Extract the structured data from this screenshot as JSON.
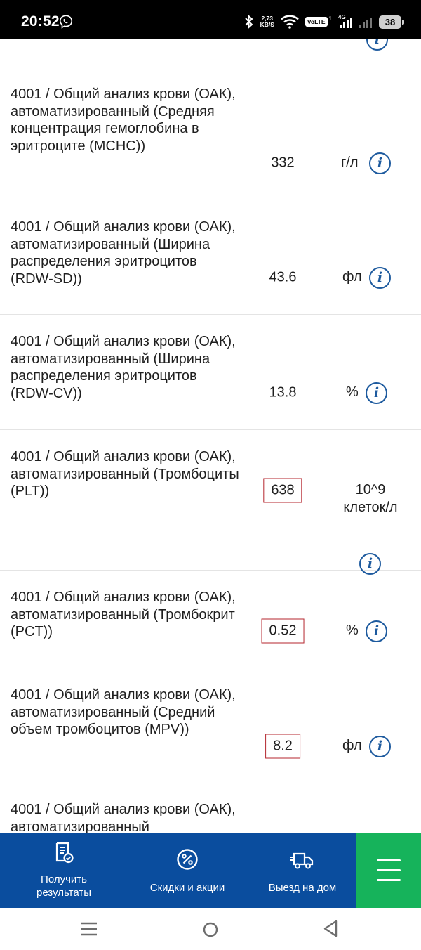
{
  "status_bar": {
    "time": "20:52",
    "speed_value": "2,73",
    "speed_unit": "KB/S",
    "volte": "VoLTE",
    "sim": "1",
    "network": "4G",
    "battery": "38"
  },
  "results": [
    {
      "name": "4001 / Общий анализ крови (ОАК), автоматизированный (Средняя концентрация гемоглобина в эритроците (MCHC))",
      "value": "332",
      "unit": "г/л",
      "flagged": false
    },
    {
      "name": "4001 / Общий анализ крови (ОАК), автоматизированный (Ширина распределения эритроцитов (RDW-SD))",
      "value": "43.6",
      "unit": "фл",
      "flagged": false
    },
    {
      "name": "4001 / Общий анализ крови (ОАК), автоматизированный (Ширина распределения эритроцитов (RDW-CV))",
      "value": "13.8",
      "unit": "%",
      "flagged": false
    },
    {
      "name": "4001 / Общий анализ крови (ОАК), автоматизированный (Тромбоциты (PLT))",
      "value": "638",
      "unit_line1": "10^9",
      "unit_line2": "клеток/л",
      "flagged": true
    },
    {
      "name": "4001 / Общий анализ крови (ОАК), автоматизированный (Тромбокрит (PCT))",
      "value": "0.52",
      "unit": "%",
      "flagged": true
    },
    {
      "name": "4001 / Общий анализ крови (ОАК), автоматизированный (Средний объем тромбоцитов (MPV))",
      "value": "8.2",
      "unit": "фл",
      "flagged": true
    },
    {
      "name": "4001 / Общий анализ крови (ОАК), автоматизированный"
    }
  ],
  "bottom_nav": {
    "get_results": "Получить результаты",
    "discounts": "Скидки и акции",
    "home_visit": "Выезд на дом"
  },
  "icons": {
    "info": "info-icon",
    "get_results": "document-check-icon",
    "discounts": "percent-icon",
    "home_visit": "delivery-truck-icon",
    "menu": "hamburger-menu-icon"
  },
  "colors": {
    "brand_blue": "#0a4d9e",
    "menu_green": "#16b35b",
    "flag_red": "#b4262e",
    "info_blue": "#1d5a9e"
  }
}
